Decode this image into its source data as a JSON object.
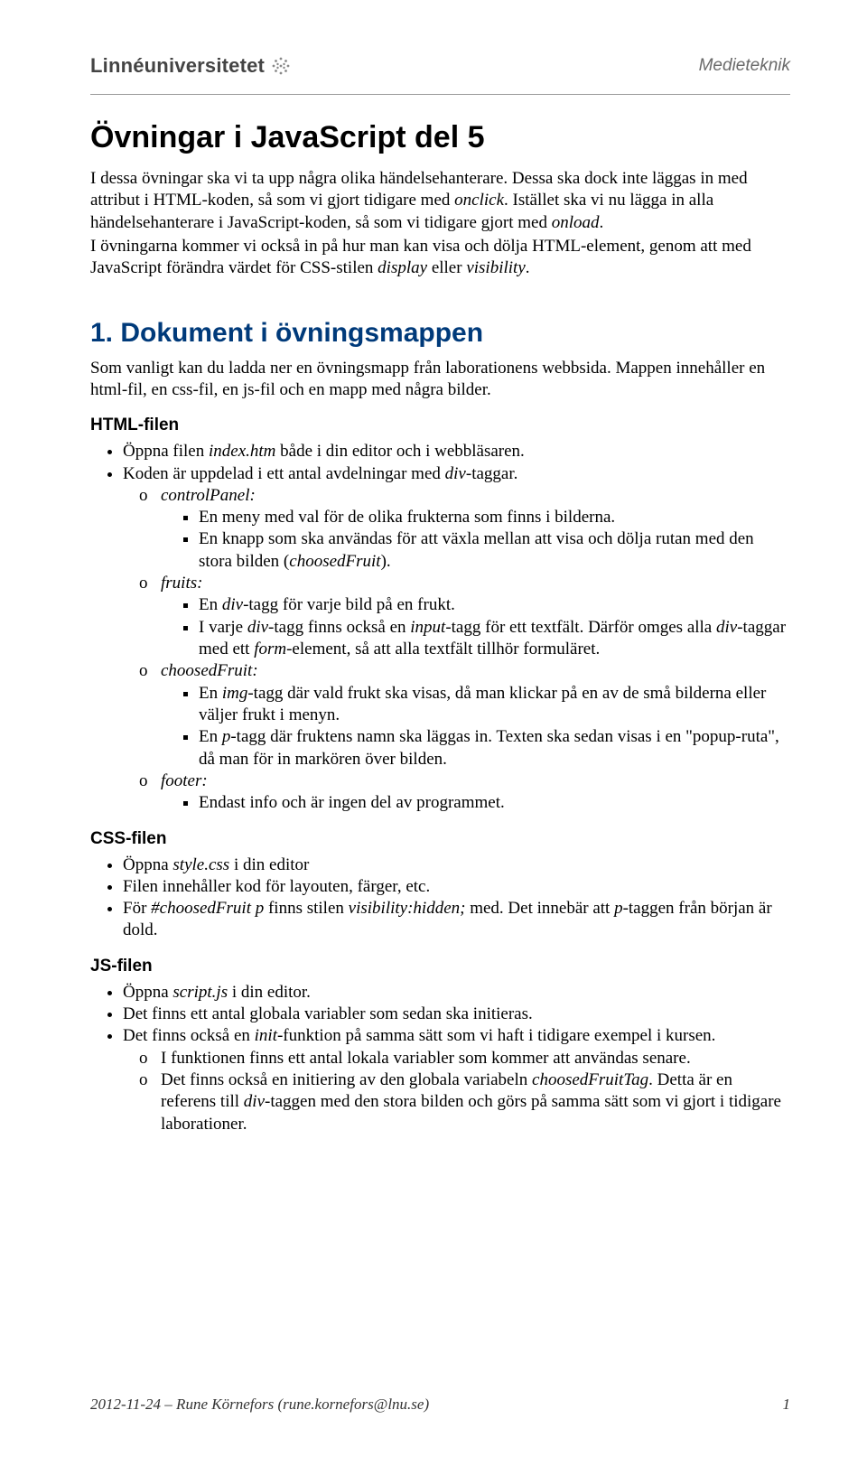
{
  "header": {
    "logo_text": "Linnéuniversitetet",
    "right": "Medieteknik"
  },
  "title": "Övningar i JavaScript del 5",
  "intro": {
    "p1a": "I dessa övningar ska vi ta upp några olika händelsehanterare. Dessa ska dock inte läggas in med attribut i HTML-koden, så som vi gjort tidigare med ",
    "p1b": "onclick",
    "p1c": ". Istället ska vi nu lägga in alla händelsehanterare i JavaScript-koden, så som vi tidigare gjort med ",
    "p1d": "onload",
    "p1e": ".",
    "p2a": "I övningarna kommer vi också in på hur man kan visa och dölja HTML-element, genom att med JavaScript förändra värdet för CSS-stilen ",
    "p2b": "display",
    "p2c": " eller ",
    "p2d": "visibility",
    "p2e": "."
  },
  "section1": {
    "heading": "1. Dokument i övningsmappen",
    "intro": "Som vanligt kan du ladda ner en övningsmapp från laborationens webbsida. Mappen innehåller en html-fil, en css-fil, en js-fil och en mapp med några bilder.",
    "html_filen": "HTML-filen",
    "html_b1a": "Öppna filen ",
    "html_b1b": "index.htm",
    "html_b1c": " både i din editor och i webbläsaren.",
    "html_b2a": "Koden är uppdelad i ett antal avdelningar med ",
    "html_b2b": "div",
    "html_b2c": "-taggar.",
    "cp_label": "controlPanel:",
    "cp_s1": "En meny med val för de olika frukterna som finns i bilderna.",
    "cp_s2a": "En knapp som ska användas för att växla mellan att visa och dölja rutan med den stora bilden (",
    "cp_s2b": "choosedFruit",
    "cp_s2c": ").",
    "fruits_label": "fruits:",
    "fr_s1a": "En ",
    "fr_s1b": "div",
    "fr_s1c": "-tagg för varje bild på en frukt.",
    "fr_s2a": "I varje ",
    "fr_s2b": "div",
    "fr_s2c": "-tagg finns också en ",
    "fr_s2d": "input",
    "fr_s2e": "-tagg för ett textfält. Därför omges alla ",
    "fr_s2f": "div",
    "fr_s2g": "-taggar med ett ",
    "fr_s2h": "form",
    "fr_s2i": "-element, så att alla textfält tillhör formuläret.",
    "cf_label": "choosedFruit:",
    "cf_s1a": "En ",
    "cf_s1b": "img",
    "cf_s1c": "-tagg där vald frukt ska visas, då man klickar på en av de små bilderna eller väljer frukt i menyn.",
    "cf_s2a": "En ",
    "cf_s2b": "p",
    "cf_s2c": "-tagg där fruktens namn ska läggas in. Texten ska sedan visas i en \"popup-ruta\", då man för in markören över bilden.",
    "footer_label": "footer:",
    "ft_s1": "Endast info och är ingen del av programmet.",
    "css_filen": "CSS-filen",
    "css_b1a": "Öppna ",
    "css_b1b": "style.css",
    "css_b1c": " i din editor",
    "css_b2": "Filen innehåller kod för layouten, färger, etc.",
    "css_b3a": "För ",
    "css_b3b": "#choosedFruit p",
    "css_b3c": " finns stilen ",
    "css_b3d": "visibility:hidden;",
    "css_b3e": " med. Det innebär att ",
    "css_b3f": "p",
    "css_b3g": "-taggen från början är dold.",
    "js_filen": "JS-filen",
    "js_b1a": "Öppna ",
    "js_b1b": "script.js",
    "js_b1c": " i din editor.",
    "js_b2": "Det finns ett antal globala variabler som sedan ska initieras.",
    "js_b3a": "Det finns också en ",
    "js_b3b": "init",
    "js_b3c": "-funktion på samma sätt som vi haft i tidigare exempel i kursen.",
    "js_o1": "I funktionen finns ett antal lokala variabler som kommer att användas senare.",
    "js_o2a": "Det finns också en initiering av den globala variabeln ",
    "js_o2b": "choosedFruitTag",
    "js_o2c": ". Detta är en referens till ",
    "js_o2d": "div",
    "js_o2e": "-taggen med den stora bilden och görs på samma sätt som vi gjort i tidigare laborationer."
  },
  "footer": {
    "left": "2012-11-24 – Rune Körnefors (rune.kornefors@lnu.se)",
    "right": "1"
  }
}
